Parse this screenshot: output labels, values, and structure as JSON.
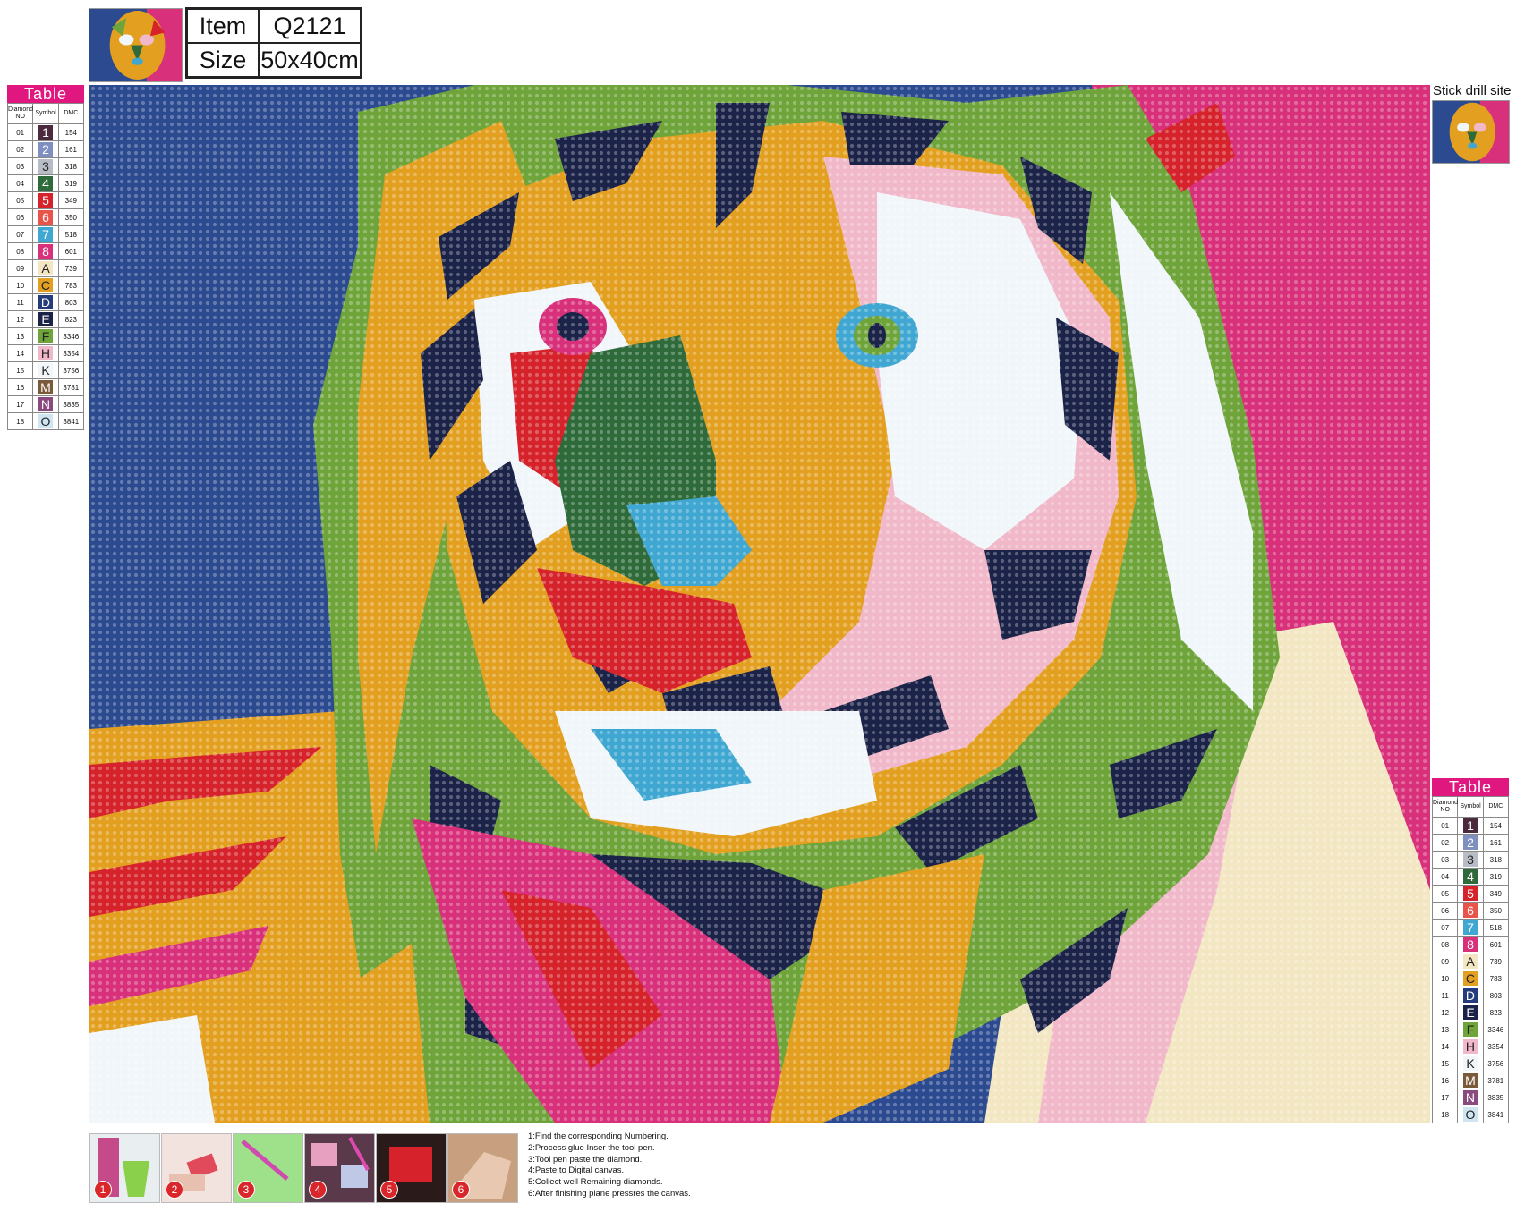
{
  "header": {
    "item_label": "Item",
    "item_value": "Q2121",
    "size_label": "Size",
    "size_value": "50x40cm"
  },
  "stick_label": "Stick drill site",
  "legend": {
    "title": "Table",
    "col_no": "Diamond NO",
    "col_symbol": "Symbol",
    "col_dmc": "DMC",
    "rows": [
      {
        "no": "01",
        "symbol": "1",
        "dmc": "154",
        "color": "#4a2a3c",
        "text": "#ffffff"
      },
      {
        "no": "02",
        "symbol": "2",
        "dmc": "161",
        "color": "#7f8fc0",
        "text": "#ffffff"
      },
      {
        "no": "03",
        "symbol": "3",
        "dmc": "318",
        "color": "#b8bcc4",
        "text": "#222222"
      },
      {
        "no": "04",
        "symbol": "4",
        "dmc": "319",
        "color": "#2f6b3a",
        "text": "#ffffff"
      },
      {
        "no": "05",
        "symbol": "5",
        "dmc": "349",
        "color": "#d6222a",
        "text": "#ffffff"
      },
      {
        "no": "06",
        "symbol": "6",
        "dmc": "350",
        "color": "#e8534a",
        "text": "#ffffff"
      },
      {
        "no": "07",
        "symbol": "7",
        "dmc": "518",
        "color": "#3fa7d1",
        "text": "#ffffff"
      },
      {
        "no": "08",
        "symbol": "8",
        "dmc": "601",
        "color": "#d8307a",
        "text": "#ffffff"
      },
      {
        "no": "09",
        "symbol": "A",
        "dmc": "739",
        "color": "#f3e6c2",
        "text": "#222222"
      },
      {
        "no": "10",
        "symbol": "C",
        "dmc": "783",
        "color": "#e3a020",
        "text": "#222222"
      },
      {
        "no": "11",
        "symbol": "D",
        "dmc": "803",
        "color": "#243c7c",
        "text": "#ffffff"
      },
      {
        "no": "12",
        "symbol": "E",
        "dmc": "823",
        "color": "#1c2348",
        "text": "#ffffff"
      },
      {
        "no": "13",
        "symbol": "F",
        "dmc": "3346",
        "color": "#6ea43a",
        "text": "#222222"
      },
      {
        "no": "14",
        "symbol": "H",
        "dmc": "3354",
        "color": "#f0b8c8",
        "text": "#222222"
      },
      {
        "no": "15",
        "symbol": "K",
        "dmc": "3756",
        "color": "#f1f6fa",
        "text": "#222222"
      },
      {
        "no": "16",
        "symbol": "M",
        "dmc": "3781",
        "color": "#7b5a3a",
        "text": "#ffffff"
      },
      {
        "no": "17",
        "symbol": "N",
        "dmc": "3835",
        "color": "#8a4a80",
        "text": "#ffffff"
      },
      {
        "no": "18",
        "symbol": "O",
        "dmc": "3841",
        "color": "#cfe6f2",
        "text": "#222222"
      }
    ]
  },
  "steps": [
    {
      "num": "1"
    },
    {
      "num": "2"
    },
    {
      "num": "3"
    },
    {
      "num": "4"
    },
    {
      "num": "5"
    },
    {
      "num": "6"
    }
  ],
  "instructions": [
    "1:Find the corresponding Numbering.",
    "2:Process glue Inser the tool pen.",
    "3:Tool pen paste the diamond.",
    "4:Paste to Digital canvas.",
    "5:Collect well Remaining diamonds.",
    "6:After finishing plane pressres the canvas."
  ]
}
